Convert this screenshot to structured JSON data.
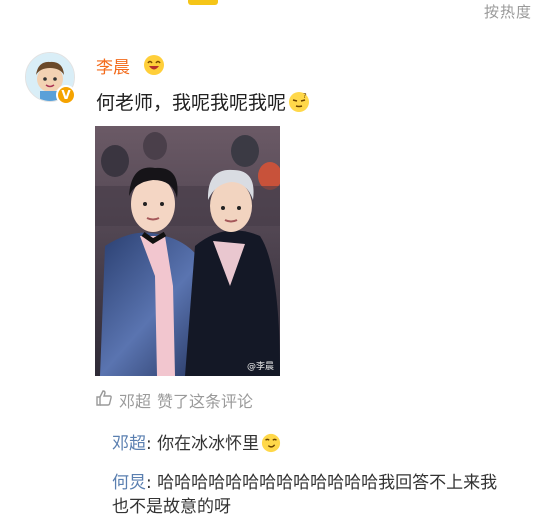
{
  "header": {
    "sort_label": "按热度"
  },
  "comment": {
    "username": "李晨",
    "level_emoji": "lol-face-icon",
    "text": "何老师，我呢我呢我呢",
    "text_emoji": "squint-face-icon",
    "photo_watermark": "@李晨"
  },
  "likes": {
    "user": "邓超",
    "text": "赞了这条评论"
  },
  "replies": [
    {
      "author": "邓超",
      "sep": ": ",
      "text": "你在冰冰怀里",
      "emoji": "smirk-face-icon"
    },
    {
      "author": "何炅",
      "sep": ": ",
      "text": "哈哈哈哈哈哈哈哈哈哈哈哈哈我回答不上来我也不是故意的呀"
    }
  ],
  "colors": {
    "username": "#f36b1c",
    "reply_author": "#5a7fb0",
    "muted": "#9a9a9a",
    "badge": "#f5a300"
  }
}
